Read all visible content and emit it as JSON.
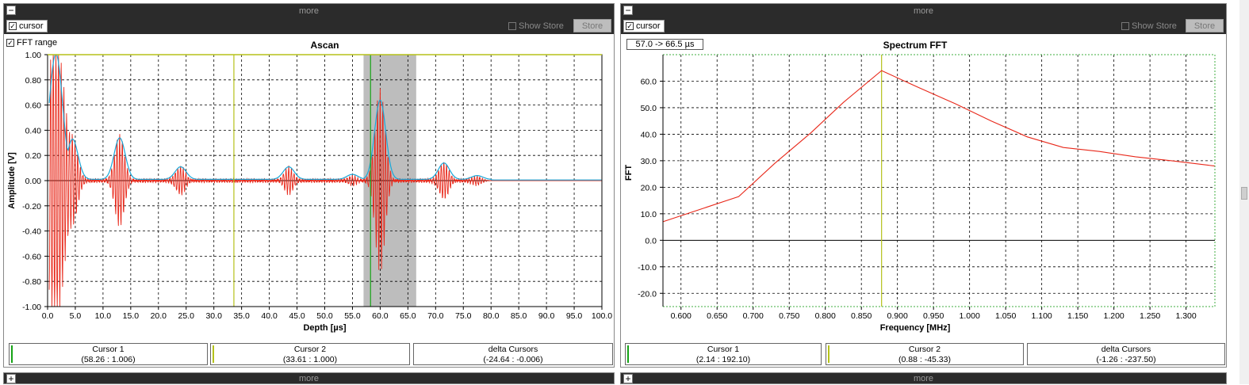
{
  "colors": {
    "header_bg": "#2b2b2b",
    "signal": "#e8281a",
    "envelope": "#1aa7d8",
    "cursor1": "#16a316",
    "cursor2": "#b5c21a",
    "fft_band": "#bdbdbd"
  },
  "left_panel": {
    "header_title": "more",
    "collapse_icon": "−",
    "cursor_label": "cursor",
    "show_store_label": "Show Store",
    "store_label": "Store",
    "fft_range_label": "FFT range",
    "cursors": [
      {
        "title": "Cursor 1",
        "value": "(58.26 : 1.006)"
      },
      {
        "title": "Cursor 2",
        "value": "(33.61 : 1.000)"
      },
      {
        "title": "delta Cursors",
        "value": "(-24.64 : -0.006)"
      }
    ]
  },
  "right_panel": {
    "header_title": "more",
    "collapse_icon": "−",
    "cursor_label": "cursor",
    "show_store_label": "Show Store",
    "store_label": "Store",
    "range_label": "57.0 -> 66.5 µs",
    "cursors": [
      {
        "title": "Cursor 1",
        "value": "(2.14 : 192.10)"
      },
      {
        "title": "Cursor 2",
        "value": "(0.88 : -45.33)"
      },
      {
        "title": "delta Cursors",
        "value": "(-1.26 : -237.50)"
      }
    ]
  },
  "bottom_bars": [
    {
      "title": "more",
      "icon": "+"
    },
    {
      "title": "more",
      "icon": "+"
    }
  ],
  "chart_data": [
    {
      "type": "line",
      "title": "Ascan",
      "xlabel": "Depth [µs]",
      "ylabel": "Amplitude [V]",
      "xlim": [
        0,
        100
      ],
      "ylim": [
        -1,
        1
      ],
      "xticks": [
        "0.0",
        "5.0",
        "10.0",
        "15.0",
        "20.0",
        "25.0",
        "30.0",
        "35.0",
        "40.0",
        "45.0",
        "50.0",
        "55.0",
        "60.0",
        "65.0",
        "70.0",
        "75.0",
        "80.0",
        "85.0",
        "90.0",
        "95.0",
        "100.0"
      ],
      "yticks": [
        "1.00",
        "0.80",
        "0.60",
        "0.40",
        "0.20",
        "0.00",
        "-0.20",
        "-0.40",
        "-0.60",
        "-0.80",
        "-1.00"
      ],
      "fft_range": [
        57.0,
        66.5
      ],
      "cursor_lines": [
        58.26,
        33.61
      ],
      "echoes": [
        {
          "t": 1.5,
          "amp": 1.0
        },
        {
          "t": 4.5,
          "amp": 0.32
        },
        {
          "t": 13.0,
          "amp": 0.33
        },
        {
          "t": 24.0,
          "amp": 0.1
        },
        {
          "t": 43.5,
          "amp": 0.1
        },
        {
          "t": 55.0,
          "amp": 0.04
        },
        {
          "t": 60.0,
          "amp": 0.63
        },
        {
          "t": 71.5,
          "amp": 0.13
        },
        {
          "t": 77.5,
          "amp": 0.03
        }
      ],
      "grid": true
    },
    {
      "type": "line",
      "title": "Spectrum FFT",
      "xlabel": "Frequency [MHz]",
      "ylabel": "FFT",
      "xlim": [
        0.575,
        1.34
      ],
      "ylim": [
        -25,
        70
      ],
      "xticks": [
        "0.600",
        "0.650",
        "0.700",
        "0.750",
        "0.800",
        "0.850",
        "0.900",
        "0.950",
        "1.000",
        "1.050",
        "1.100",
        "1.150",
        "1.200",
        "1.250",
        "1.300"
      ],
      "yticks": [
        "60.0",
        "50.0",
        "40.0",
        "30.0",
        "20.0",
        "10.0",
        "0.0",
        "-10.0",
        "-20.0"
      ],
      "x": [
        0.575,
        0.68,
        0.73,
        0.78,
        0.825,
        0.878,
        0.93,
        0.98,
        1.03,
        1.08,
        1.13,
        1.18,
        1.23,
        1.28,
        1.34
      ],
      "y": [
        7.0,
        16.5,
        29.0,
        40.5,
        52.0,
        64.0,
        57.5,
        51.5,
        45.0,
        39.0,
        35.0,
        33.5,
        31.5,
        30.0,
        28.0
      ],
      "cursor_lines": [
        0.878
      ],
      "grid": true
    }
  ]
}
